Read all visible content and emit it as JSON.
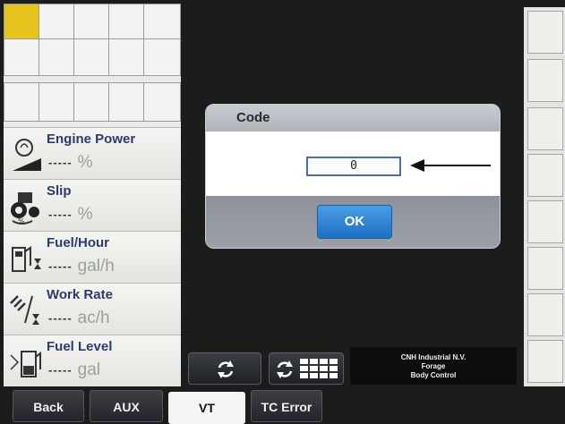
{
  "metrics": [
    {
      "label": "Engine Power",
      "value": "-----",
      "unit": "%",
      "icon": "engine-icon"
    },
    {
      "label": "Slip",
      "value": "-----",
      "unit": "%",
      "icon": "tractor-slip-icon"
    },
    {
      "label": "Fuel/Hour",
      "value": "-----",
      "unit": "gal/h",
      "icon": "fuel-pump-hourglass-icon"
    },
    {
      "label": "Work Rate",
      "value": "-----",
      "unit": "ac/h",
      "icon": "field-hourglass-icon"
    },
    {
      "label": "Fuel Level",
      "value": "-----",
      "unit": "gal",
      "icon": "fuel-tank-icon"
    }
  ],
  "tabs": [
    {
      "label": "Back"
    },
    {
      "label": "AUX"
    },
    {
      "label": "VT"
    },
    {
      "label": "TC Error"
    }
  ],
  "dialog": {
    "title": "Code",
    "input_value": "0",
    "ok_label": "OK"
  },
  "info": {
    "line1": "CNH Industrial N.V.",
    "line2": "Forage",
    "line3": "Body Control"
  },
  "colors": {
    "accent_yellow": "#e6c21d",
    "ok_blue": "#2a7fd4",
    "label_navy": "#2d3a6a"
  }
}
